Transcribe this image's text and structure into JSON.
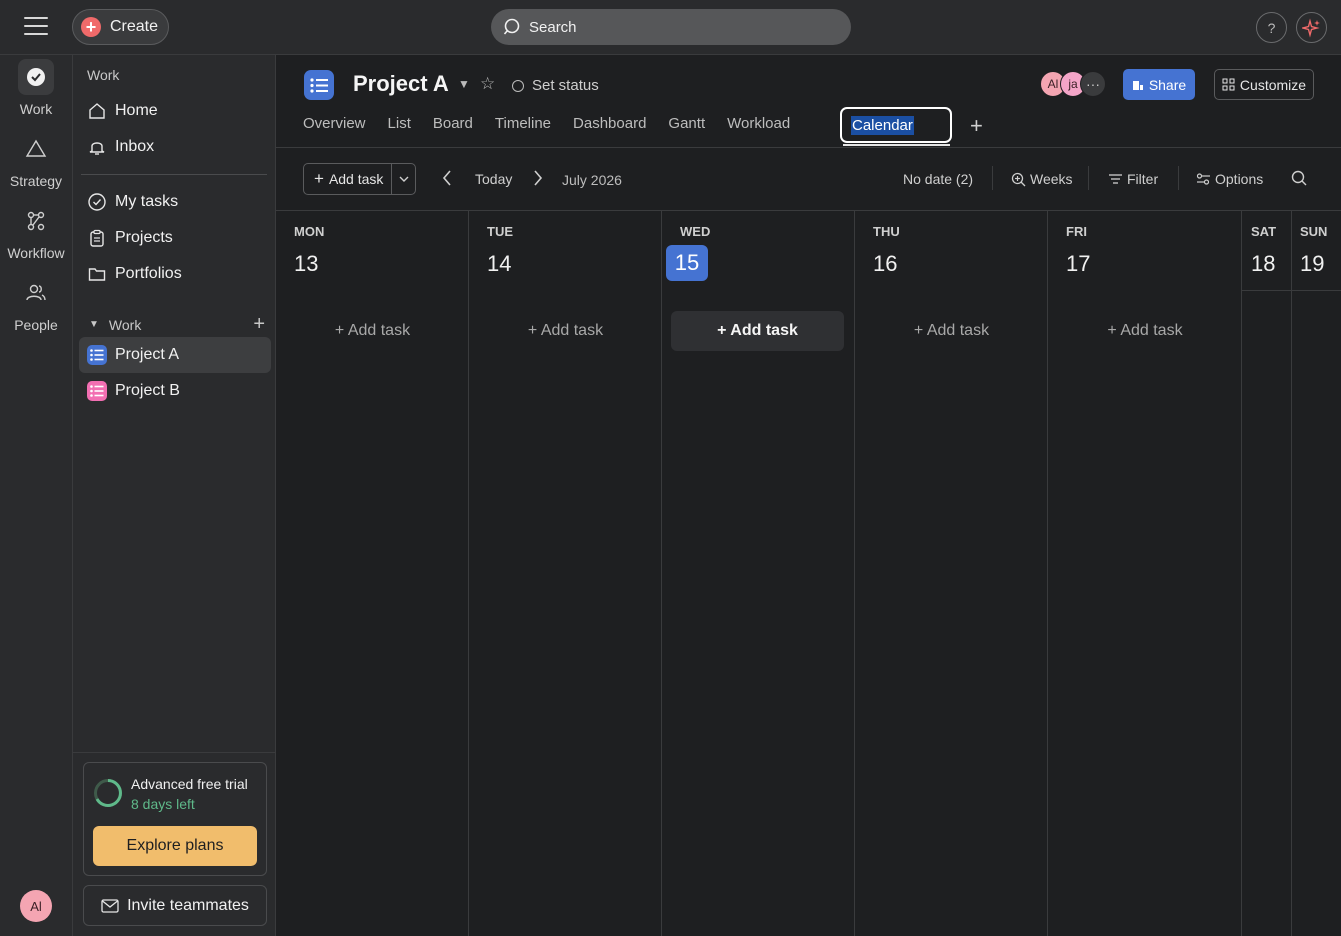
{
  "topbar": {
    "create_label": "Create",
    "search_placeholder": "Search",
    "help_label": "?"
  },
  "rail": {
    "items": [
      {
        "label": "Work",
        "icon": "check-circle-icon"
      },
      {
        "label": "Strategy",
        "icon": "triangle-icon"
      },
      {
        "label": "Workflow",
        "icon": "workflow-icon"
      },
      {
        "label": "People",
        "icon": "people-icon"
      }
    ],
    "user_initials": "Al"
  },
  "sidebar": {
    "header": "Work",
    "top_items": [
      {
        "label": "Home",
        "icon": "home-icon"
      },
      {
        "label": "Inbox",
        "icon": "bell-icon"
      }
    ],
    "mid_items": [
      {
        "label": "My tasks",
        "icon": "check-circle-icon"
      },
      {
        "label": "Projects",
        "icon": "clipboard-icon"
      },
      {
        "label": "Portfolios",
        "icon": "folder-icon"
      }
    ],
    "section_label": "Work",
    "projects": [
      {
        "label": "Project A",
        "color": "#4573d2"
      },
      {
        "label": "Project B",
        "color": "#f26fb2"
      }
    ],
    "trial": {
      "title": "Advanced free trial",
      "days_left": "8 days left",
      "explore_label": "Explore plans"
    },
    "invite_label": "Invite teammates"
  },
  "project": {
    "title": "Project A",
    "set_status": "Set status",
    "tabs": [
      "Overview",
      "List",
      "Board",
      "Timeline",
      "Dashboard",
      "Gantt",
      "Workload"
    ],
    "active_tab": "Calendar",
    "avatars": [
      {
        "initials": "Al",
        "color": "#f4a5b2"
      },
      {
        "initials": "ja",
        "color": "#f4a5c8"
      }
    ],
    "more_label": "···",
    "share_label": "Share",
    "customize_label": "Customize"
  },
  "toolbar": {
    "add_task_label": "Add task",
    "today_label": "Today",
    "month_label": "July 2026",
    "no_date_label": "No date (2)",
    "weeks_label": "Weeks",
    "filter_label": "Filter",
    "options_label": "Options"
  },
  "calendar": {
    "add_task_label": "+ Add task",
    "days": [
      {
        "dow": "MON",
        "date": "13"
      },
      {
        "dow": "TUE",
        "date": "14"
      },
      {
        "dow": "WED",
        "date": "15",
        "today": true
      },
      {
        "dow": "THU",
        "date": "16"
      },
      {
        "dow": "FRI",
        "date": "17"
      },
      {
        "dow": "SAT",
        "date": "18"
      },
      {
        "dow": "SUN",
        "date": "19"
      }
    ]
  }
}
